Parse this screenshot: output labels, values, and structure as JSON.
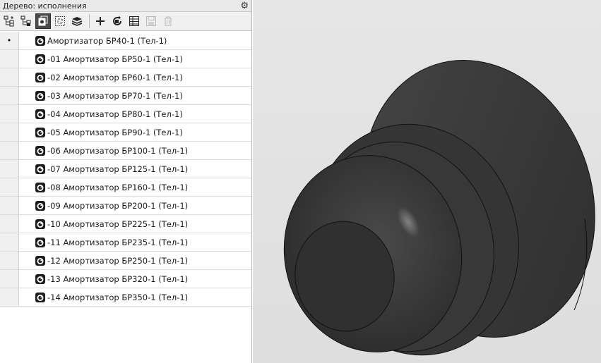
{
  "panel": {
    "title": "Дерево: исполнения",
    "settings_icon": "gear-icon"
  },
  "toolbar": {
    "buttons": [
      {
        "name": "tree-structure-icon",
        "state": "normal"
      },
      {
        "name": "tree-branch-icon",
        "state": "normal"
      },
      {
        "name": "variants-icon",
        "state": "active"
      },
      {
        "name": "select-frame-icon",
        "state": "normal"
      },
      {
        "name": "layers-icon",
        "state": "normal"
      },
      {
        "name": "add-icon",
        "state": "normal"
      },
      {
        "name": "refresh-icon",
        "state": "normal"
      },
      {
        "name": "table-icon",
        "state": "normal"
      },
      {
        "name": "save-icon",
        "state": "disabled"
      },
      {
        "name": "delete-icon",
        "state": "disabled"
      }
    ]
  },
  "tree": {
    "items": [
      {
        "label": "Амортизатор БР40-1 (Тел-1)",
        "current": true
      },
      {
        "label": "-01 Амортизатор БР50-1 (Тел-1)",
        "current": false
      },
      {
        "label": "-02 Амортизатор БР60-1 (Тел-1)",
        "current": false
      },
      {
        "label": "-03 Амортизатор БР70-1 (Тел-1)",
        "current": false
      },
      {
        "label": "-04 Амортизатор БР80-1 (Тел-1)",
        "current": false
      },
      {
        "label": "-05 Амортизатор БР90-1 (Тел-1)",
        "current": false
      },
      {
        "label": "-06 Амортизатор БР100-1 (Тел-1)",
        "current": false
      },
      {
        "label": "-07 Амортизатор БР125-1 (Тел-1)",
        "current": false
      },
      {
        "label": "-08 Амортизатор БР160-1 (Тел-1)",
        "current": false
      },
      {
        "label": "-09 Амортизатор БР200-1 (Тел-1)",
        "current": false
      },
      {
        "label": "-10 Амортизатор БР225-1 (Тел-1)",
        "current": false
      },
      {
        "label": "-11 Амортизатор БР235-1 (Тел-1)",
        "current": false
      },
      {
        "label": "-12 Амортизатор БР250-1 (Тел-1)",
        "current": false
      },
      {
        "label": "-13 Амортизатор БР320-1 (Тел-1)",
        "current": false
      },
      {
        "label": "-14 Амортизатор БР350-1 (Тел-1)",
        "current": false
      }
    ],
    "current_marker": "•",
    "item_icon": "part-icon"
  },
  "viewport": {
    "model": "shock-absorber-model",
    "colors": {
      "background": "#e2e2e2",
      "model": "#3a3a3a"
    }
  }
}
